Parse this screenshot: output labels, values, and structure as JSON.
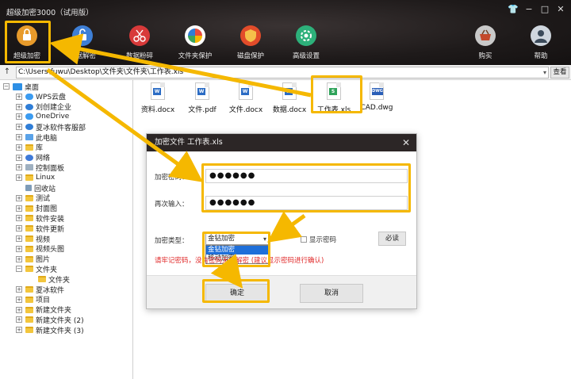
{
  "app": {
    "title": "超级加密3000（试用版）"
  },
  "window_controls": {
    "skin": "👕",
    "minimize": "−",
    "maximize": "□",
    "close": "✕"
  },
  "toolbar": [
    {
      "label": "超级加密",
      "icon": "lock-icon",
      "color": "#e89b2b"
    },
    {
      "label": "数据解密",
      "icon": "unlock-icon",
      "color": "#3e7fd6"
    },
    {
      "label": "数据粉碎",
      "icon": "scissors-icon",
      "color": "#d83a3a"
    },
    {
      "label": "文件夹保护",
      "icon": "pinwheel-icon",
      "color": "#ffffff"
    },
    {
      "label": "磁盘保护",
      "icon": "shield-icon",
      "color": "#e24c2a"
    },
    {
      "label": "高级设置",
      "icon": "settings-icon",
      "color": "#2db07a"
    },
    {
      "label": "购买",
      "icon": "basket-icon",
      "color": "#c9c9c9"
    },
    {
      "label": "帮助",
      "icon": "user-icon",
      "color": "#cfd6de"
    }
  ],
  "pathbar": {
    "up": "↑",
    "path": "C:\\Users\\fuwu\\Desktop\\文件夹\\文件夹\\工作表.xls",
    "view_label": "查看"
  },
  "tree": [
    {
      "label": "桌面",
      "expander": "−",
      "icon": "desktop"
    },
    {
      "label": "WPS云盘",
      "expander": "+",
      "icon": "cloud"
    },
    {
      "label": "刘创建企业",
      "expander": "+",
      "icon": "user"
    },
    {
      "label": "OneDrive",
      "expander": "+",
      "icon": "cloud"
    },
    {
      "label": "夏冰软件客服部",
      "expander": "+",
      "icon": "user"
    },
    {
      "label": "此电脑",
      "expander": "+",
      "icon": "pc"
    },
    {
      "label": "库",
      "expander": "+",
      "icon": "folder"
    },
    {
      "label": "网络",
      "expander": "+",
      "icon": "net"
    },
    {
      "label": "控制面板",
      "expander": "+",
      "icon": "grey"
    },
    {
      "label": "Linux",
      "expander": "+",
      "icon": "folder"
    },
    {
      "label": "回收站",
      "expander": "",
      "icon": "trash"
    },
    {
      "label": "测试",
      "expander": "+",
      "icon": "folder"
    },
    {
      "label": "封面图",
      "expander": "+",
      "icon": "folder"
    },
    {
      "label": "软件安装",
      "expander": "+",
      "icon": "folder"
    },
    {
      "label": "软件更新",
      "expander": "+",
      "icon": "folder"
    },
    {
      "label": "视频",
      "expander": "+",
      "icon": "folder"
    },
    {
      "label": "视频头图",
      "expander": "+",
      "icon": "folder"
    },
    {
      "label": "图片",
      "expander": "+",
      "icon": "folder"
    },
    {
      "label": "文件夹",
      "expander": "−",
      "icon": "folder"
    },
    {
      "label": "文件夹",
      "expander": "",
      "icon": "folder",
      "level": 2
    },
    {
      "label": "夏冰软件",
      "expander": "+",
      "icon": "folder"
    },
    {
      "label": "项目",
      "expander": "+",
      "icon": "folder"
    },
    {
      "label": "新建文件夹",
      "expander": "+",
      "icon": "folder"
    },
    {
      "label": "新建文件夹 (2)",
      "expander": "+",
      "icon": "folder"
    },
    {
      "label": "新建文件夹 (3)",
      "expander": "+",
      "icon": "folder"
    }
  ],
  "files": [
    {
      "name": "资料.docx",
      "type": "W",
      "color": "#2b6cc4"
    },
    {
      "name": "文件.pdf",
      "type": "W",
      "color": "#2b6cc4"
    },
    {
      "name": "文件.docx",
      "type": "W",
      "color": "#2b6cc4"
    },
    {
      "name": "数据.docx",
      "type": "W",
      "color": "#2b6cc4"
    },
    {
      "name": "工作表.xls",
      "type": "S",
      "color": "#2fa35a"
    },
    {
      "name": "CAD.dwg",
      "type": "DWG",
      "color": "#2a5fb8"
    }
  ],
  "dialog": {
    "title": "加密文件  工作表.xls",
    "close": "✕",
    "password_label": "加密密码：",
    "password_value": "●●●●●●",
    "confirm_label": "再次输入：",
    "confirm_value": "●●●●●●",
    "type_label": "加密类型：",
    "type_selected": "金钻加密",
    "type_options": [
      "金钻加密",
      "移动加密"
    ],
    "show_password": "显示密码",
    "must_read": "必读",
    "warning": "请牢记密码，没有密码无法解密 (建议显示密码进行确认)",
    "ok": "确定",
    "cancel": "取消"
  },
  "colors": {
    "highlight": "#f5b800",
    "dark_bar": "#1e1a1a",
    "warning": "#e02a2a"
  }
}
